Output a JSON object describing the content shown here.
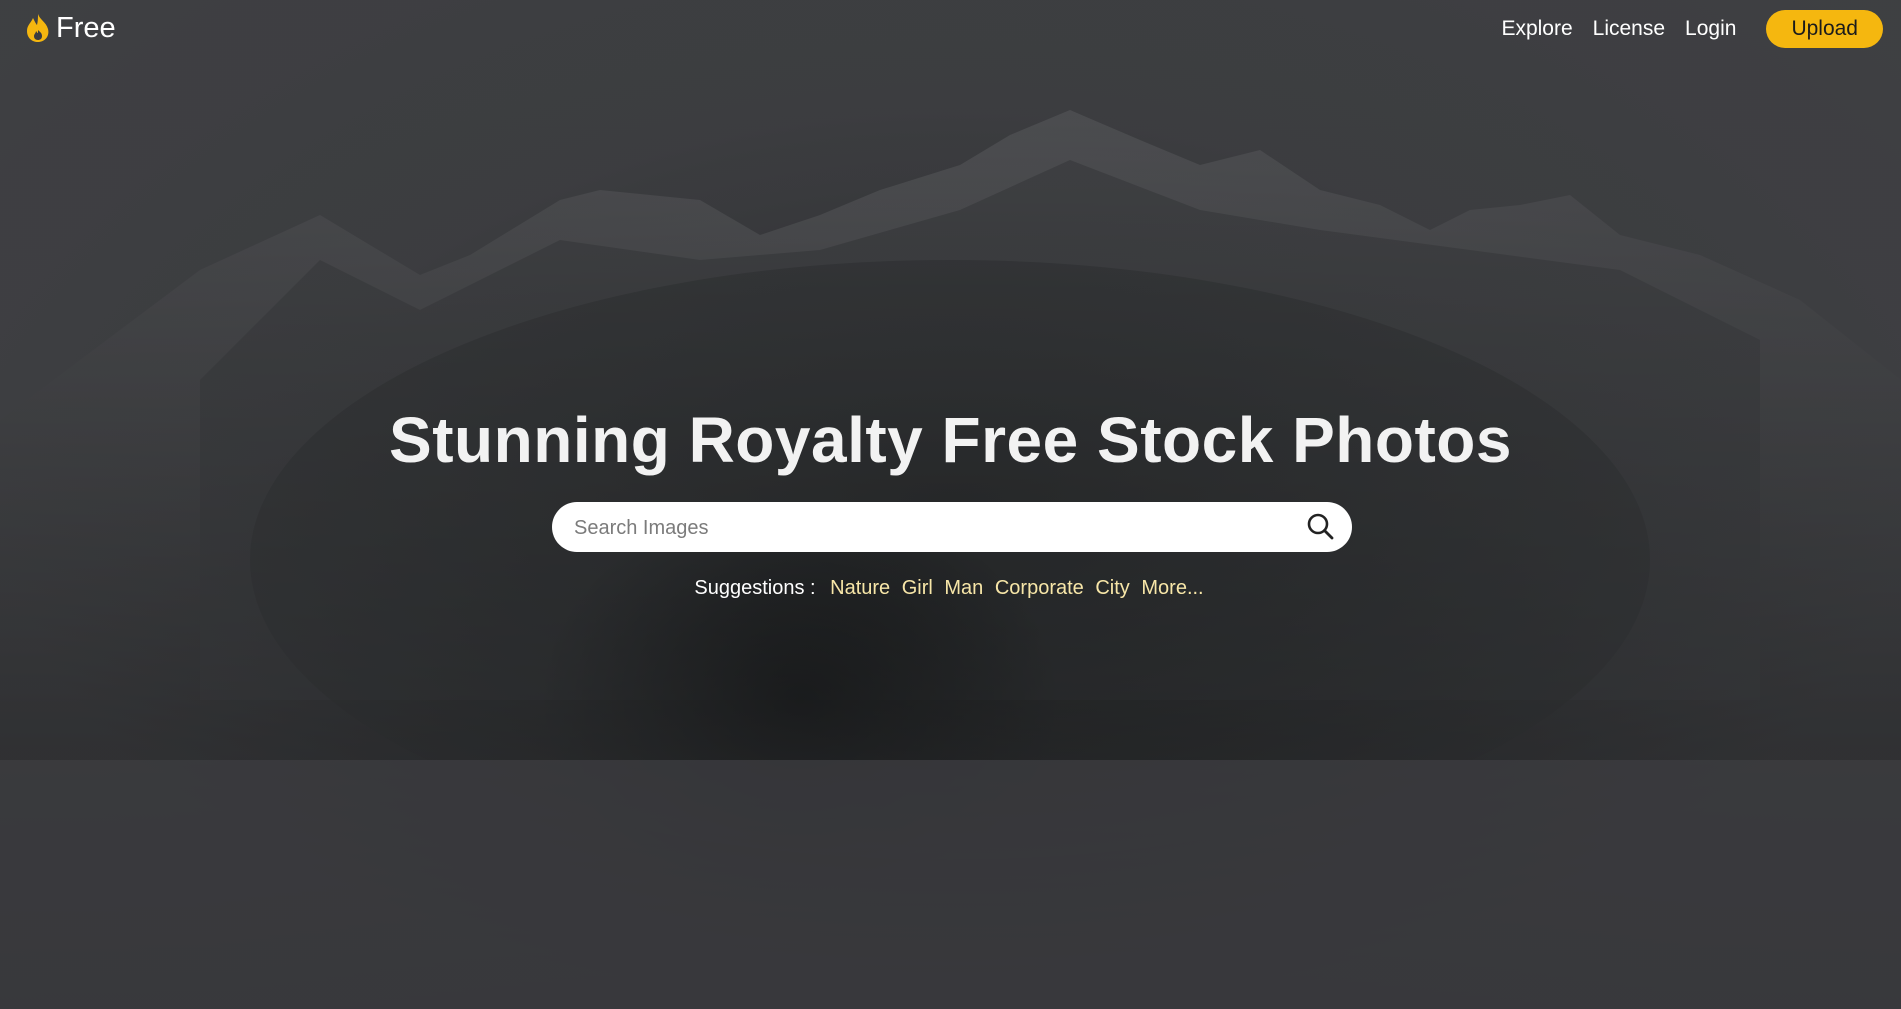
{
  "header": {
    "logo_text": "Free",
    "nav": {
      "explore": "Explore",
      "license": "License",
      "login": "Login",
      "upload": "Upload"
    }
  },
  "hero": {
    "title": "Stunning Royalty Free Stock Photos",
    "search": {
      "placeholder": "Search Images",
      "value": ""
    },
    "suggestions": {
      "label": "Suggestions :",
      "items": [
        "Nature",
        "Girl",
        "Man",
        "Corporate",
        "City",
        "More..."
      ]
    }
  },
  "colors": {
    "accent": "#f5b70f",
    "suggestion_link": "#f7e6a8",
    "background": "#3b3c3f"
  },
  "icons": {
    "logo": "flame-icon",
    "search": "search-icon"
  }
}
